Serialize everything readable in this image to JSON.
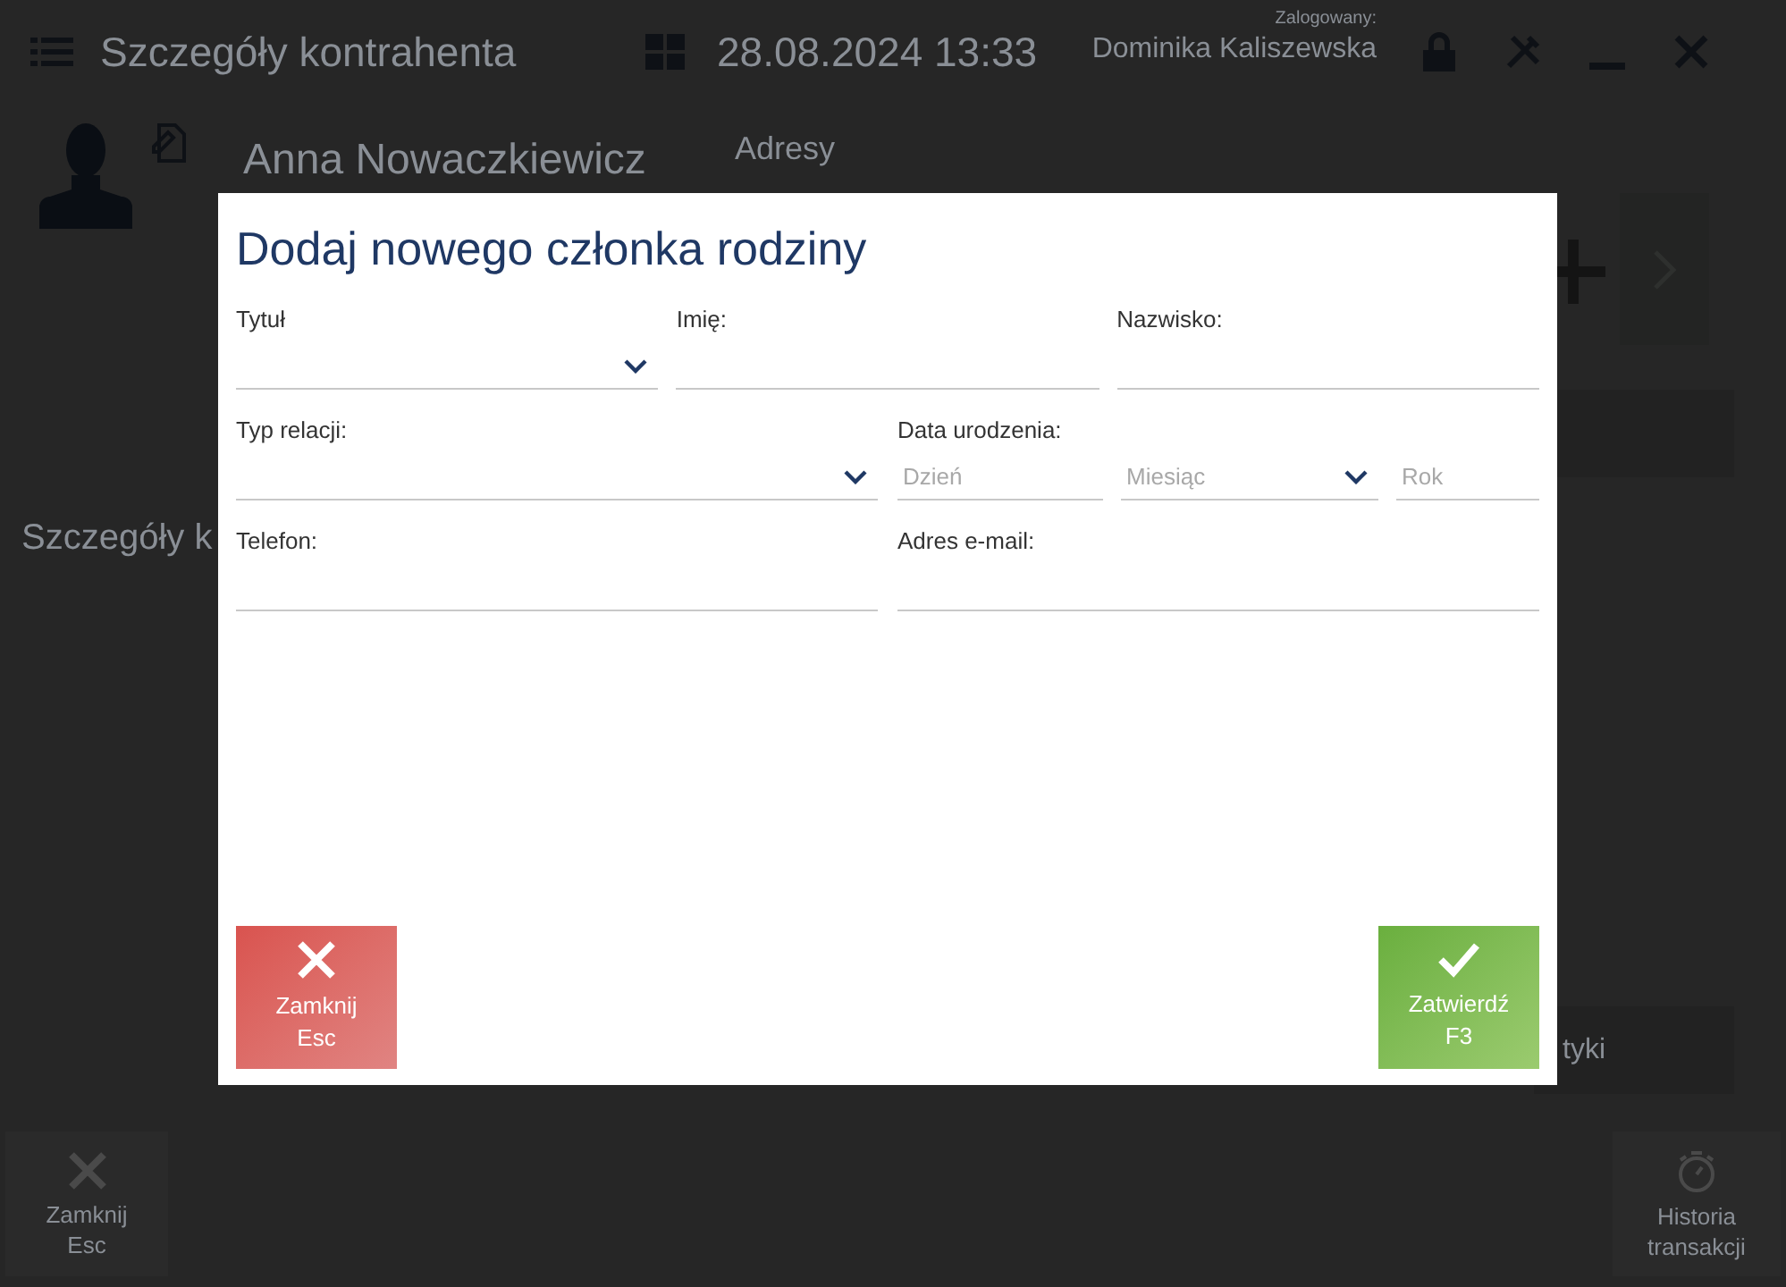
{
  "header": {
    "title": "Szczegóły kontrahenta",
    "datetime": "28.08.2024 13:33",
    "logged_in_label": "Zalogowany:",
    "user": "Dominika Kaliszewska"
  },
  "customer": {
    "name": "Anna Nowaczkiewicz",
    "tab": "Adresy",
    "section": "Szczegóły k",
    "tile_text": "tyki"
  },
  "footer_buttons": [
    {
      "kind": "close",
      "label": "Zamknij",
      "shortcut": "Esc"
    },
    {
      "kind": "history",
      "label": "Historia transakcji"
    }
  ],
  "dialog": {
    "title": "Dodaj nowego członka rodziny",
    "rows": [
      [
        {
          "kind": "select",
          "label": "Tytuł"
        },
        {
          "kind": "text",
          "label": "Imię:"
        },
        {
          "kind": "text",
          "label": "Nazwisko:"
        }
      ],
      [
        {
          "kind": "select",
          "label": "Typ relacji:"
        },
        {
          "kind": "date",
          "label": "Data urodzenia:",
          "parts": [
            {
              "kind": "text",
              "placeholder": "Dzień"
            },
            {
              "kind": "select",
              "placeholder": "Miesiąc"
            },
            {
              "kind": "text",
              "placeholder": "Rok"
            }
          ]
        }
      ],
      [
        {
          "kind": "text",
          "label": "Telefon:"
        },
        {
          "kind": "text",
          "label": "Adres e-mail:"
        }
      ]
    ],
    "buttons": [
      {
        "kind": "cancel",
        "label": "Zamknij",
        "shortcut": "Esc"
      },
      {
        "kind": "confirm",
        "label": "Zatwierdź",
        "shortcut": "F3"
      }
    ]
  }
}
